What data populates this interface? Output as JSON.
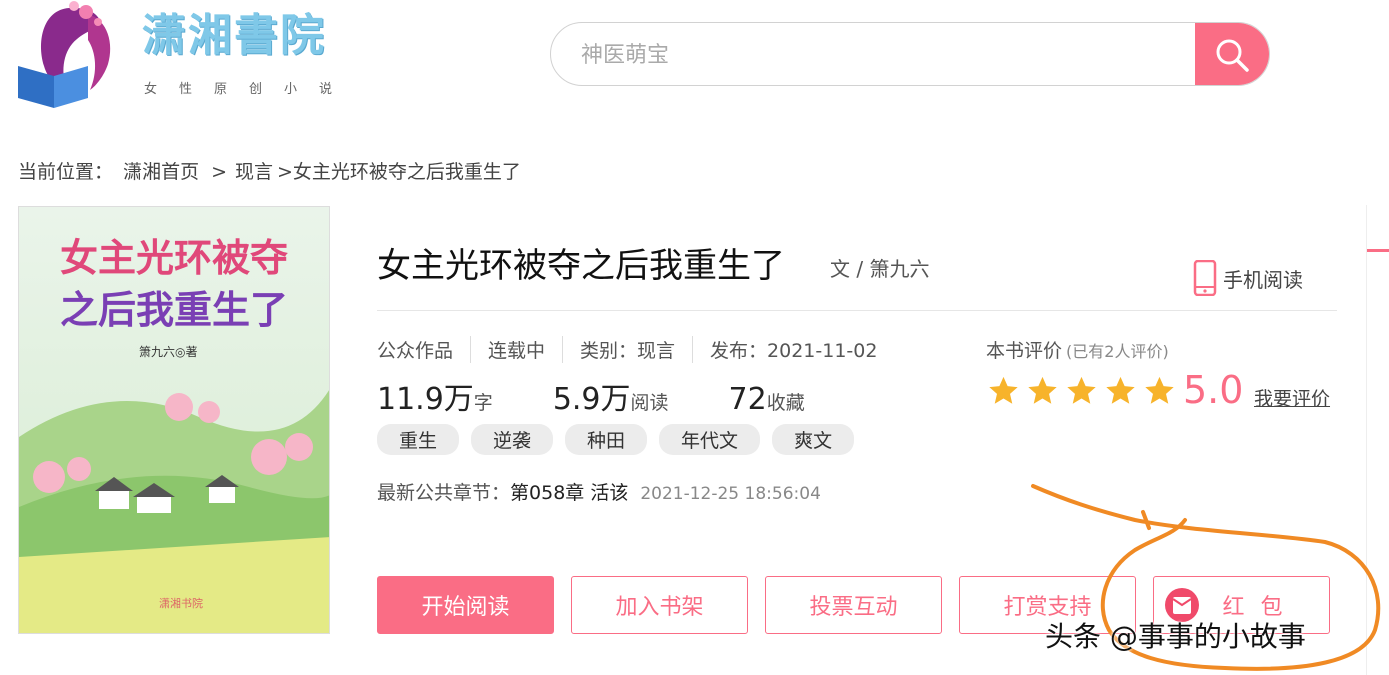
{
  "header": {
    "logo_text": "潇湘書院",
    "logo_sub": "女性原创小说",
    "search_placeholder": "神医萌宝"
  },
  "breadcrumb": {
    "label": "当前位置：",
    "home": "潇湘首页",
    "sep": ">",
    "category": "现言",
    "current": ">女主光环被夺之后我重生了"
  },
  "book": {
    "cover_title_line1": "女主光环被夺",
    "cover_title_line2": "之后我重生了",
    "cover_author": "箫九六◎著",
    "cover_publisher": "潇湘书院",
    "title": "女主光环被夺之后我重生了",
    "author": "文 / 箫九六",
    "mobile_read": "手机阅读",
    "meta": [
      "公众作品",
      "连载中",
      "类别：现言",
      "发布：2021-11-02"
    ],
    "stats": [
      {
        "num": "11.9万",
        "unit": "字"
      },
      {
        "num": "5.9万",
        "unit": "阅读"
      },
      {
        "num": "72",
        "unit": "收藏"
      }
    ],
    "tags": [
      "重生",
      "逆袭",
      "种田",
      "年代文",
      "爽文"
    ],
    "latest_label": "最新公共章节：",
    "latest_chapter": "第058章 活该",
    "latest_time": "2021-12-25 18:56:04"
  },
  "rating": {
    "label": "本书评价",
    "count_text": "(已有2人评价)",
    "stars": 5,
    "score": "5.0",
    "rate_link": "我要评价"
  },
  "actions": {
    "start_read": "开始阅读",
    "add_shelf": "加入书架",
    "vote": "投票互动",
    "tip": "打赏支持",
    "red_packet": "红包"
  },
  "watermark": "头条 @事事的小故事",
  "colors": {
    "accent": "#fa6d85",
    "star": "#f7b32b",
    "annotation": "#f08a24"
  }
}
